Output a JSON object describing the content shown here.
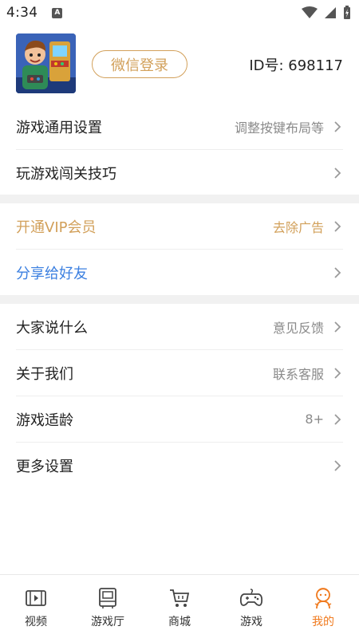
{
  "status": {
    "time": "4:34",
    "notif_letter": "A"
  },
  "profile": {
    "login_label": "微信登录",
    "user_id": "ID号: 698117"
  },
  "group1": [
    {
      "label": "游戏通用设置",
      "hint": "调整按键布局等"
    },
    {
      "label": "玩游戏闯关技巧",
      "hint": ""
    }
  ],
  "group2": [
    {
      "label": "开通VIP会员",
      "hint": "去除广告"
    },
    {
      "label": "分享给好友",
      "hint": ""
    }
  ],
  "group3": [
    {
      "label": "大家说什么",
      "hint": "意见反馈"
    },
    {
      "label": "关于我们",
      "hint": "联系客服"
    },
    {
      "label": "游戏适龄",
      "hint": "8+"
    },
    {
      "label": "更多设置",
      "hint": ""
    }
  ],
  "tabs": [
    {
      "label": "视频",
      "icon": "video-icon"
    },
    {
      "label": "游戏厅",
      "icon": "arcade-icon"
    },
    {
      "label": "商城",
      "icon": "cart-icon"
    },
    {
      "label": "游戏",
      "icon": "gamepad-icon"
    },
    {
      "label": "我的",
      "icon": "profile-icon",
      "active": true
    }
  ],
  "colors": {
    "accent_gold": "#d2a05a",
    "share_blue": "#3b7fe0",
    "tab_active": "#f07a1e"
  }
}
